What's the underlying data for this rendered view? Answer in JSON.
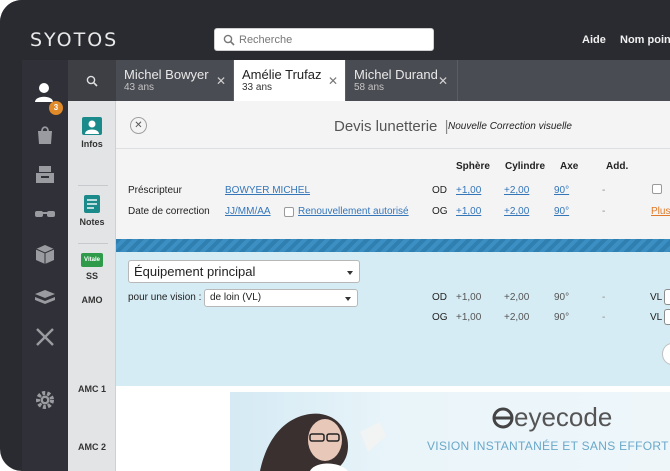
{
  "app": {
    "logo": "SYOTOS"
  },
  "search": {
    "placeholder": "Recherche"
  },
  "top_links": {
    "help": "Aide",
    "point": "Nom point"
  },
  "rail": {
    "badge_count": "3"
  },
  "tabs": [
    {
      "name": "Michel Bowyer",
      "age": "43 ans",
      "active": false
    },
    {
      "name": "Amélie Trufaz",
      "age": "33 ans",
      "active": true
    },
    {
      "name": "Michel Durand",
      "age": "58 ans",
      "active": false
    }
  ],
  "sidenav": {
    "infos": "Infos",
    "notes": "Notes",
    "vitale": "Vitale",
    "ss": "SS",
    "amo": "AMO",
    "amc1": "AMC 1",
    "amc2": "AMC 2"
  },
  "header": {
    "title": "Devis lunetterie",
    "subtitle": "Nouvelle Correction visuelle"
  },
  "prescription": {
    "col_sphere": "Sphère",
    "col_cylindre": "Cylindre",
    "col_axe": "Axe",
    "col_add": "Add.",
    "prescripteur_label": "Préscripteur",
    "prescripteur_value": "BOWYER MICHEL",
    "date_label": "Date de correction",
    "date_value": "JJ/MM/AA",
    "renouvellement": "Renouvellement autorisé",
    "od": "OD",
    "og": "OG",
    "od_sphere": "+1,00",
    "od_cylindre": "+2,00",
    "od_axe": "90°",
    "od_add": "-",
    "og_sphere": "+1,00",
    "og_cylindre": "+2,00",
    "og_axe": "90°",
    "og_add": "-",
    "plus_link": "Plus"
  },
  "equipement": {
    "select": "Équipement principal",
    "vision_label": "pour une vision :",
    "vision_value": "de loin (VL)",
    "od": "OD",
    "og": "OG",
    "od_sphere": "+1,00",
    "od_cylindre": "+2,00",
    "od_axe": "90°",
    "od_add": "-",
    "og_sphere": "+1,00",
    "og_cylindre": "+2,00",
    "og_axe": "90°",
    "og_add": "-",
    "vl1": "VL",
    "vl2": "VL"
  },
  "promo": {
    "brand": "eyecode",
    "tagline": "VISION INSTANTANÉE ET SANS EFFORT"
  },
  "colors": {
    "dark": "#2a2b31",
    "accent_blue": "#3576b8",
    "stripe": "#2f7fb0",
    "equip_bg": "#d6ecf4",
    "orange": "#e07a2a",
    "teal_icon": "#1a8a8a"
  }
}
